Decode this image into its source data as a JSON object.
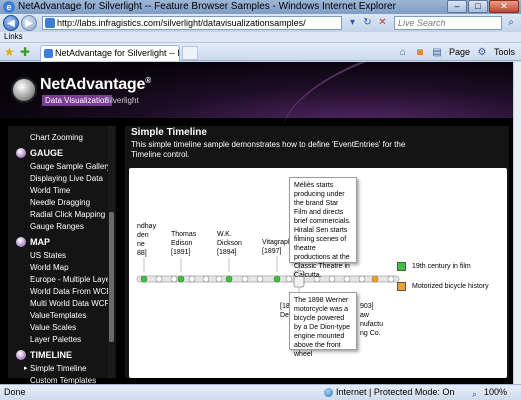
{
  "window": {
    "title": "NetAdvantage for Silverlight -- Feature Browser Samples - Windows Internet Explorer",
    "controls": [
      "–",
      "□",
      "✕"
    ]
  },
  "address": {
    "url": "http://labs.infragistics.com/silverlight/datavisualizationsamples/",
    "search_placeholder": "Live Search"
  },
  "links_bar": {
    "label": "Links"
  },
  "tab": {
    "label": "NetAdvantage for Silverlight -- Feature Browser Samples"
  },
  "command_bar": {
    "page_label": "Page",
    "tools_label": "Tools"
  },
  "app": {
    "logo_main": "NetAdvantage",
    "logo_reg": "®",
    "logo_sub1": "Data Visualization",
    "logo_sub2": "Silverlight"
  },
  "sidebar": {
    "items_top": [
      "Chart Zooming"
    ],
    "gauge_header": "GAUGE",
    "gauge_items": [
      "Gauge Sample Gallery",
      "Displaying Live Data",
      "World Time",
      "Needle Dragging",
      "Radial Click Mapping",
      "Gauge Ranges"
    ],
    "map_header": "MAP",
    "map_items": [
      "US States",
      "World Map",
      "Europe - Multiple Layer",
      "World Data From WCF",
      "Multi World Data WCF",
      "ValueTemplates",
      "Value Scales",
      "Layer Palettes"
    ],
    "timeline_header": "TIMELINE",
    "timeline_items": [
      "Simple Timeline",
      "Custom Templates"
    ]
  },
  "main": {
    "title": "Simple Timeline",
    "description": "This simple timeline sample demonstrates how to define 'EventEntries' for the Timeline control."
  },
  "timeline": {
    "top_callout": "Méliès starts producing under the brand Star Film and directs brief commercials. Hiralal Sen starts filming scenes of theatre productions at the Classic Theatre in Calcutta.",
    "bottom_callout": "The 1898 Werner motorcycle was a bicycle powered by a De Dion-type engine mounted above the front wheel",
    "labels_above": [
      "ndhay\nden\nne\n88]",
      "Thomas\nEdison\n[1891]",
      "W.K.\nDickson\n[1894]",
      "Vitagraph\n[1897]"
    ],
    "labels_below": [
      "[189\nDe D",
      "903]\naw\nnufactu\nng Co."
    ],
    "legend": [
      {
        "label": "19th century in film",
        "color": "#3cc23c"
      },
      {
        "label": "Motorized bicycle history",
        "color": "#f0a030"
      }
    ]
  },
  "status": {
    "left": "Done",
    "zone": "Internet | Protected Mode: On",
    "zoom": "100%"
  }
}
